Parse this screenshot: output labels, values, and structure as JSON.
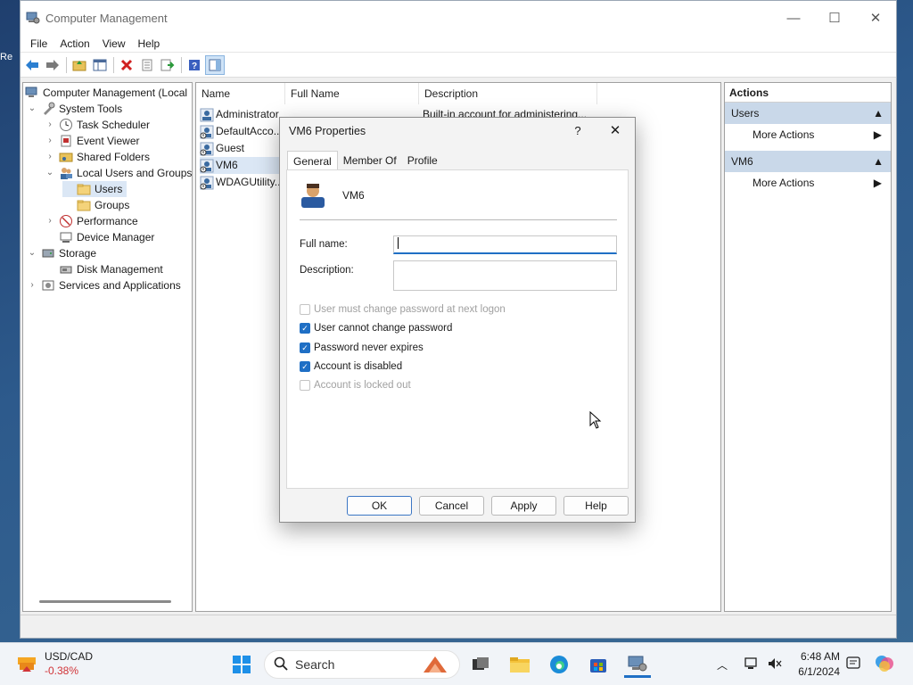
{
  "window": {
    "title": "Computer Management",
    "controls": {
      "minimize": "—",
      "maximize": "☐",
      "close": "✕"
    }
  },
  "menu": [
    "File",
    "Action",
    "View",
    "Help"
  ],
  "tree": {
    "root": "Computer Management (Local",
    "system_tools": "System Tools",
    "task_scheduler": "Task Scheduler",
    "event_viewer": "Event Viewer",
    "shared_folders": "Shared Folders",
    "local_users_groups": "Local Users and Groups",
    "users": "Users",
    "groups": "Groups",
    "performance": "Performance",
    "device_manager": "Device Manager",
    "storage": "Storage",
    "disk_management": "Disk Management",
    "services_apps": "Services and Applications"
  },
  "list": {
    "columns": {
      "name": "Name",
      "full_name": "Full Name",
      "description": "Description"
    },
    "rows": [
      {
        "name": "Administrator",
        "full_name": "",
        "description": "Built-in account for administering..."
      },
      {
        "name": "DefaultAcco...",
        "full_name": "",
        "description": ""
      },
      {
        "name": "Guest",
        "full_name": "",
        "description": ""
      },
      {
        "name": "VM6",
        "full_name": "",
        "description": ""
      },
      {
        "name": "WDAGUtility...",
        "full_name": "",
        "description": ""
      }
    ]
  },
  "actions": {
    "title": "Actions",
    "section1": "Users",
    "section1_item": "More Actions",
    "section2": "VM6",
    "section2_item": "More Actions"
  },
  "dialog": {
    "title": "VM6 Properties",
    "help_glyph": "?",
    "close_glyph": "✕",
    "tabs": [
      "General",
      "Member Of",
      "Profile"
    ],
    "user_name": "VM6",
    "full_name_label": "Full name:",
    "full_name_value": "",
    "description_label": "Description:",
    "description_value": "",
    "checkboxes": [
      {
        "label": "User must change password at next logon",
        "checked": false,
        "enabled": false
      },
      {
        "label": "User cannot change password",
        "checked": true,
        "enabled": true
      },
      {
        "label": "Password never expires",
        "checked": true,
        "enabled": true
      },
      {
        "label": "Account is disabled",
        "checked": true,
        "enabled": true
      },
      {
        "label": "Account is locked out",
        "checked": false,
        "enabled": false
      }
    ],
    "buttons": {
      "ok": "OK",
      "cancel": "Cancel",
      "apply": "Apply",
      "help": "Help"
    }
  },
  "taskbar": {
    "widget_title": "USD/CAD",
    "widget_value": "-0.38%",
    "search_placeholder": "Search",
    "time": "6:48 AM",
    "date": "6/1/2024"
  },
  "colors": {
    "accent": "#1f6fc5",
    "selection": "#dbe7f5",
    "action_header": "#c9d8e9",
    "widget_negative": "#d13438"
  }
}
